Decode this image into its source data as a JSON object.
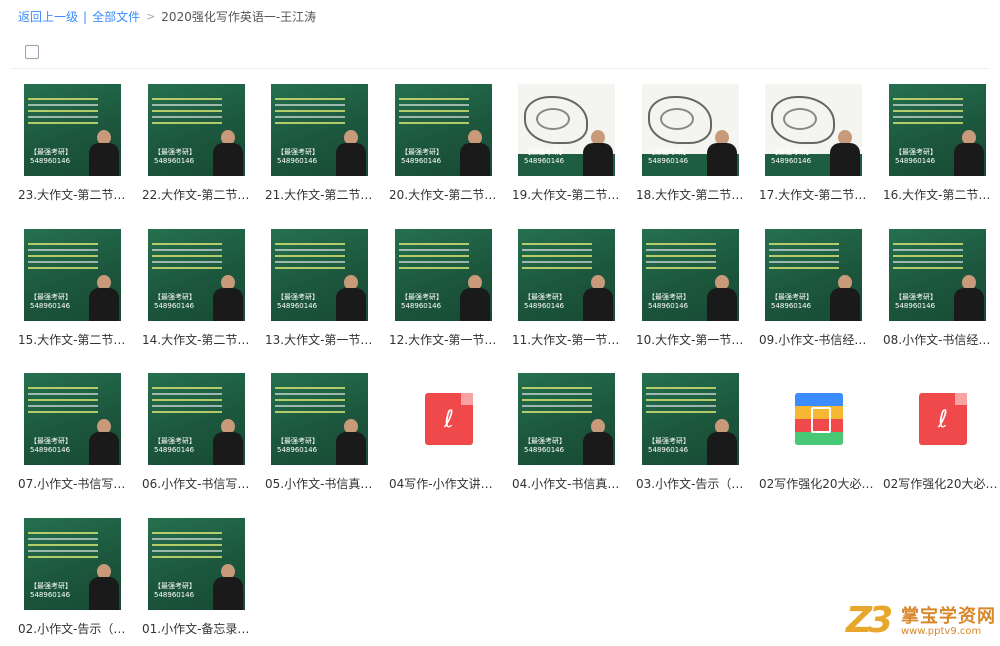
{
  "breadcrumb": {
    "back": "返回上一级",
    "all_files": "全部文件",
    "current": "2020强化写作英语一-王江涛"
  },
  "watermark": {
    "line1": "【最强考研】",
    "line2": "548960146"
  },
  "logo": {
    "mark": "Z3",
    "name": "掌宝学资网",
    "url": "www.pptv9.com"
  },
  "files": [
    {
      "name": "23.大作文-第二节…",
      "type": "video"
    },
    {
      "name": "22.大作文-第二节…",
      "type": "video"
    },
    {
      "name": "21.大作文-第二节…",
      "type": "video"
    },
    {
      "name": "20.大作文-第二节…",
      "type": "video"
    },
    {
      "name": "19.大作文-第二节…",
      "type": "video-sketch"
    },
    {
      "name": "18.大作文-第二节…",
      "type": "video-sketch"
    },
    {
      "name": "17.大作文-第二节…",
      "type": "video-sketch"
    },
    {
      "name": "16.大作文-第二节…",
      "type": "video"
    },
    {
      "name": "15.大作文-第二节…",
      "type": "video"
    },
    {
      "name": "14.大作文-第二节…",
      "type": "video"
    },
    {
      "name": "13.大作文-第一节…",
      "type": "video"
    },
    {
      "name": "12.大作文-第一节…",
      "type": "video"
    },
    {
      "name": "11.大作文-第一节…",
      "type": "video"
    },
    {
      "name": "10.大作文-第一节…",
      "type": "video"
    },
    {
      "name": "09.小作文-书信经…",
      "type": "video"
    },
    {
      "name": "08.小作文-书信经…",
      "type": "video"
    },
    {
      "name": "07.小作文-书信写…",
      "type": "video"
    },
    {
      "name": "06.小作文-书信写…",
      "type": "video"
    },
    {
      "name": "05.小作文-书信真…",
      "type": "video"
    },
    {
      "name": "04写作-小作文讲…",
      "type": "pdf"
    },
    {
      "name": "04.小作文-书信真…",
      "type": "video"
    },
    {
      "name": "03.小作文-告示（…",
      "type": "video"
    },
    {
      "name": "02写作强化20大必…",
      "type": "zip"
    },
    {
      "name": "02写作强化20大必…",
      "type": "pdf"
    },
    {
      "name": "02.小作文-告示（…",
      "type": "video"
    },
    {
      "name": "01.小作文-备忘录…",
      "type": "video"
    }
  ]
}
